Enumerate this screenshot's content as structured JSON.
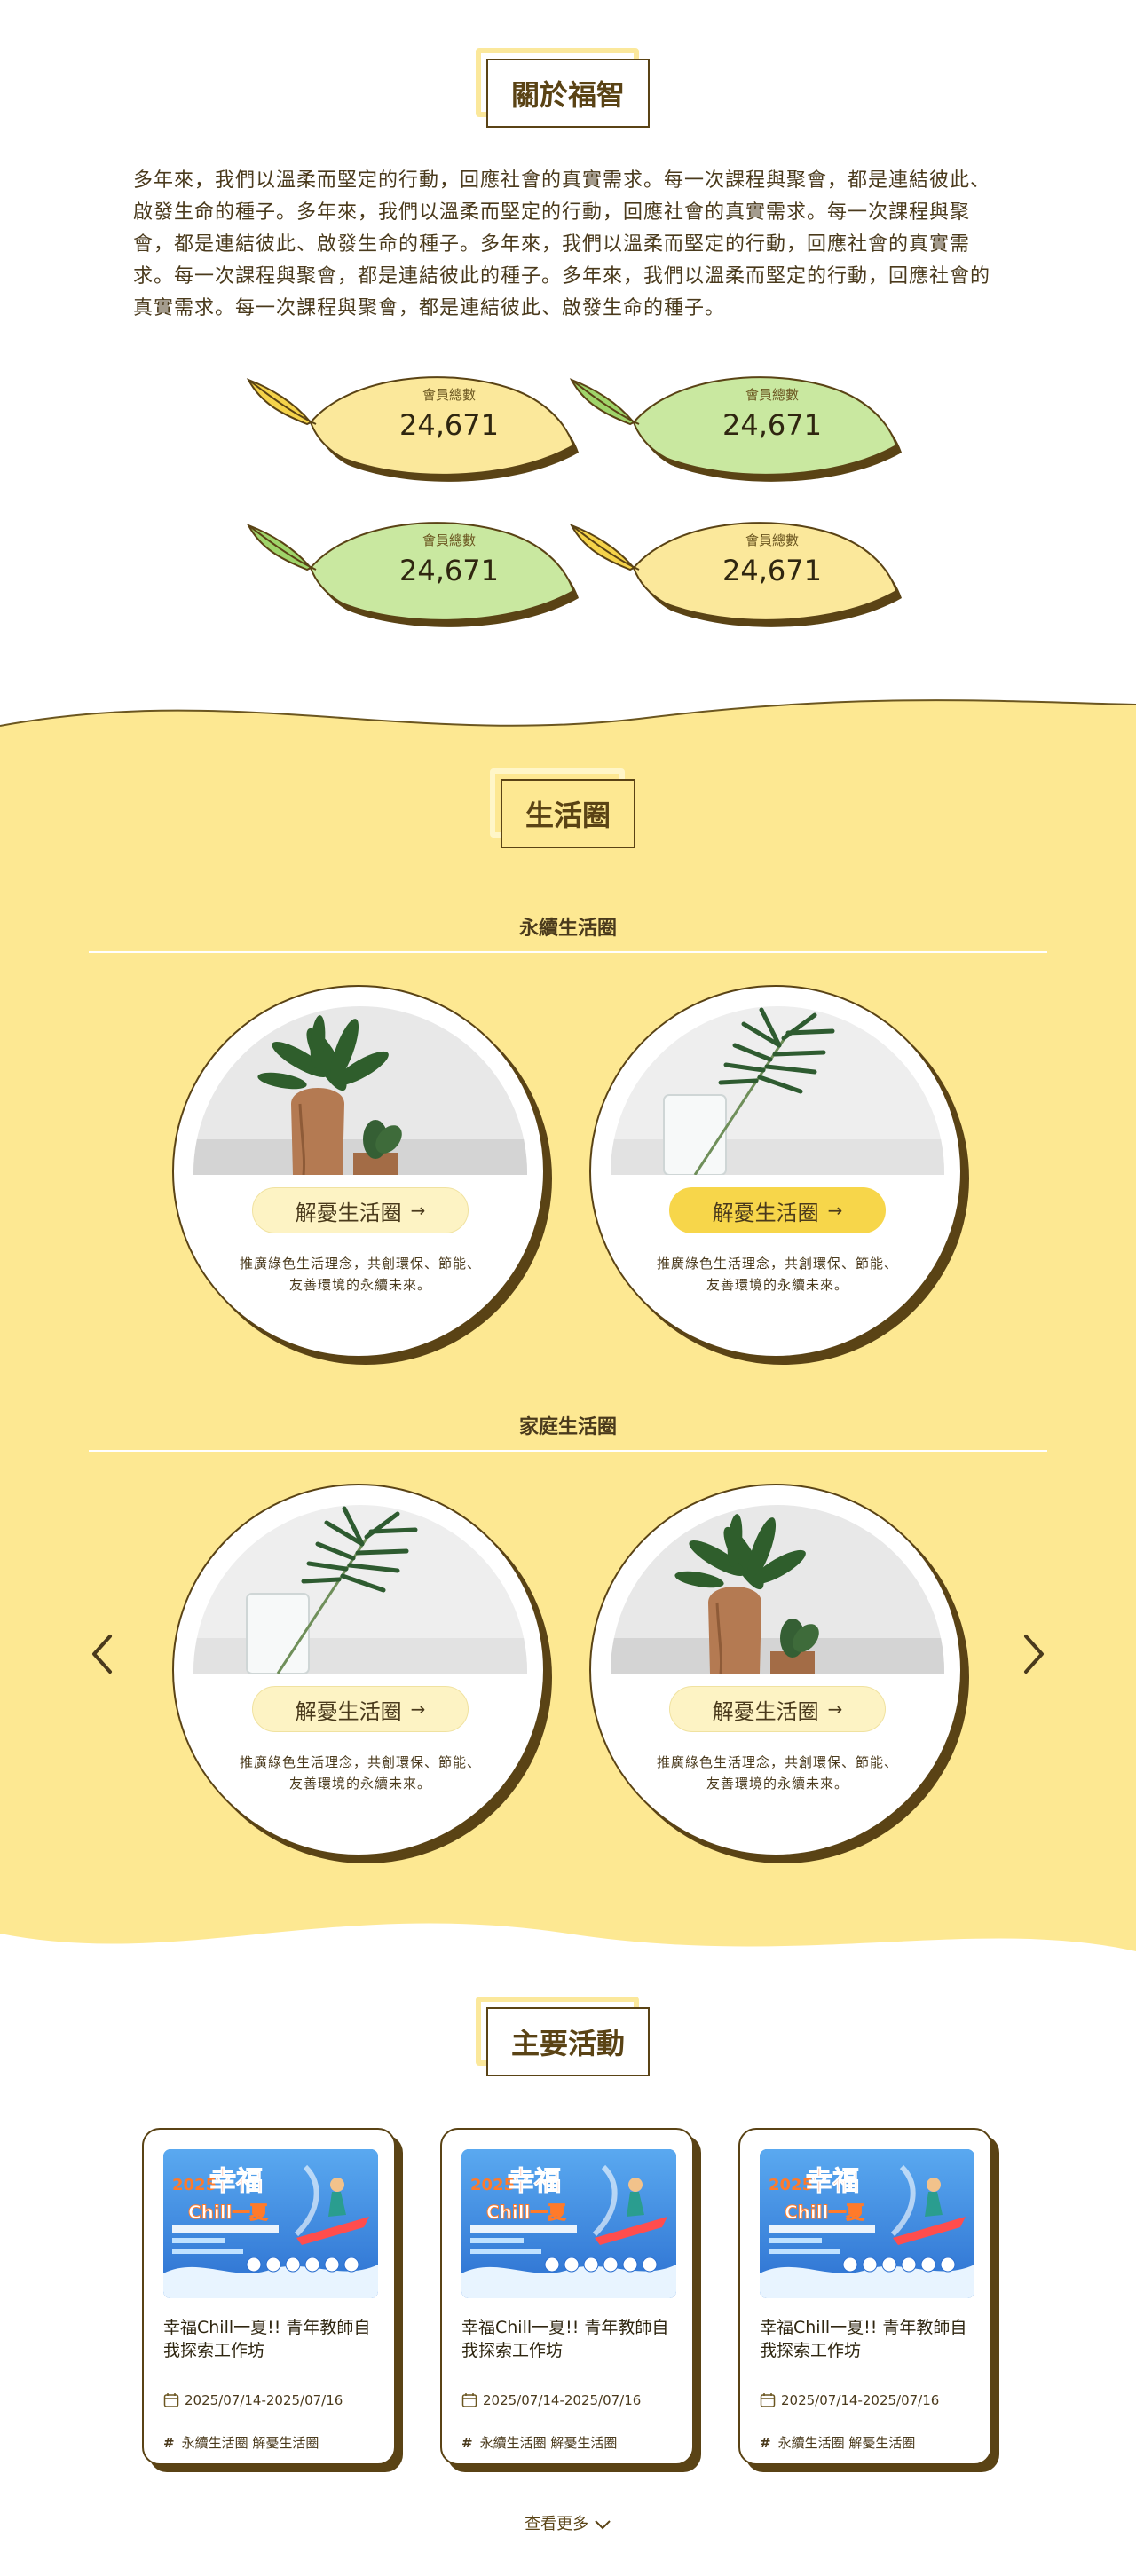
{
  "about": {
    "title": "關於福智",
    "body": "多年來，我們以溫柔而堅定的行動，回應社會的真實需求。每一次課程與聚會，都是連結彼此、啟發生命的種子。多年來，我們以溫柔而堅定的行動，回應社會的真實需求。每一次課程與聚會，都是連結彼此、啟發生命的種子。多年來，我們以溫柔而堅定的行動，回應社會的真實需求。每一次課程與聚會，都是連結彼此的種子。多年來，我們以溫柔而堅定的行動，回應社會的真實需求。每一次課程與聚會，都是連結彼此、啟發生命的種子。"
  },
  "stats": [
    {
      "label": "會員總數",
      "value": "24,671",
      "color": "#fbe89b"
    },
    {
      "label": "會員總數",
      "value": "24,671",
      "color": "#c9e8a0"
    },
    {
      "label": "會員總數",
      "value": "24,671",
      "color": "#c9e8a0"
    },
    {
      "label": "會員總數",
      "value": "24,671",
      "color": "#fbe89b"
    }
  ],
  "life": {
    "title": "生活圈",
    "groups": [
      {
        "heading": "永續生活圈",
        "cards": [
          {
            "button": "解憂生活圈",
            "desc": "推廣綠色生活理念，共創環保、節能、友善環境的永續未來。",
            "image": "vase-plant"
          },
          {
            "button": "解憂生活圈",
            "desc": "推廣綠色生活理念，共創環保、節能、友善環境的永續未來。",
            "image": "glass-palm"
          }
        ]
      },
      {
        "heading": "家庭生活圈",
        "cards": [
          {
            "button": "解憂生活圈",
            "desc": "推廣綠色生活理念，共創環保、節能、友善環境的永續未來。",
            "image": "glass-palm"
          },
          {
            "button": "解憂生活圈",
            "desc": "推廣綠色生活理念，共創環保、節能、友善環境的永續未來。",
            "image": "vase-plant"
          }
        ]
      }
    ]
  },
  "activities": {
    "title": "主要活動",
    "cards": [
      {
        "title": "幸福Chill一夏!! 青年教師自我探索工作坊",
        "date": "2025/07/14-2025/07/16",
        "tags": "永續生活圈 解憂生活圈"
      },
      {
        "title": "幸福Chill一夏!! 青年教師自我探索工作坊",
        "date": "2025/07/14-2025/07/16",
        "tags": "永續生活圈 解憂生活圈"
      },
      {
        "title": "幸福Chill一夏!! 青年教師自我探索工作坊",
        "date": "2025/07/14-2025/07/16",
        "tags": "永續生活圈 解憂生活圈"
      }
    ],
    "poster_text": {
      "year": "2025",
      "big": "幸福",
      "sub": "Chill一夏"
    },
    "more": "查看更多"
  },
  "colors": {
    "brand_yellow": "#fde892",
    "brown": "#5a4315",
    "active_button": "#f7d64a"
  }
}
